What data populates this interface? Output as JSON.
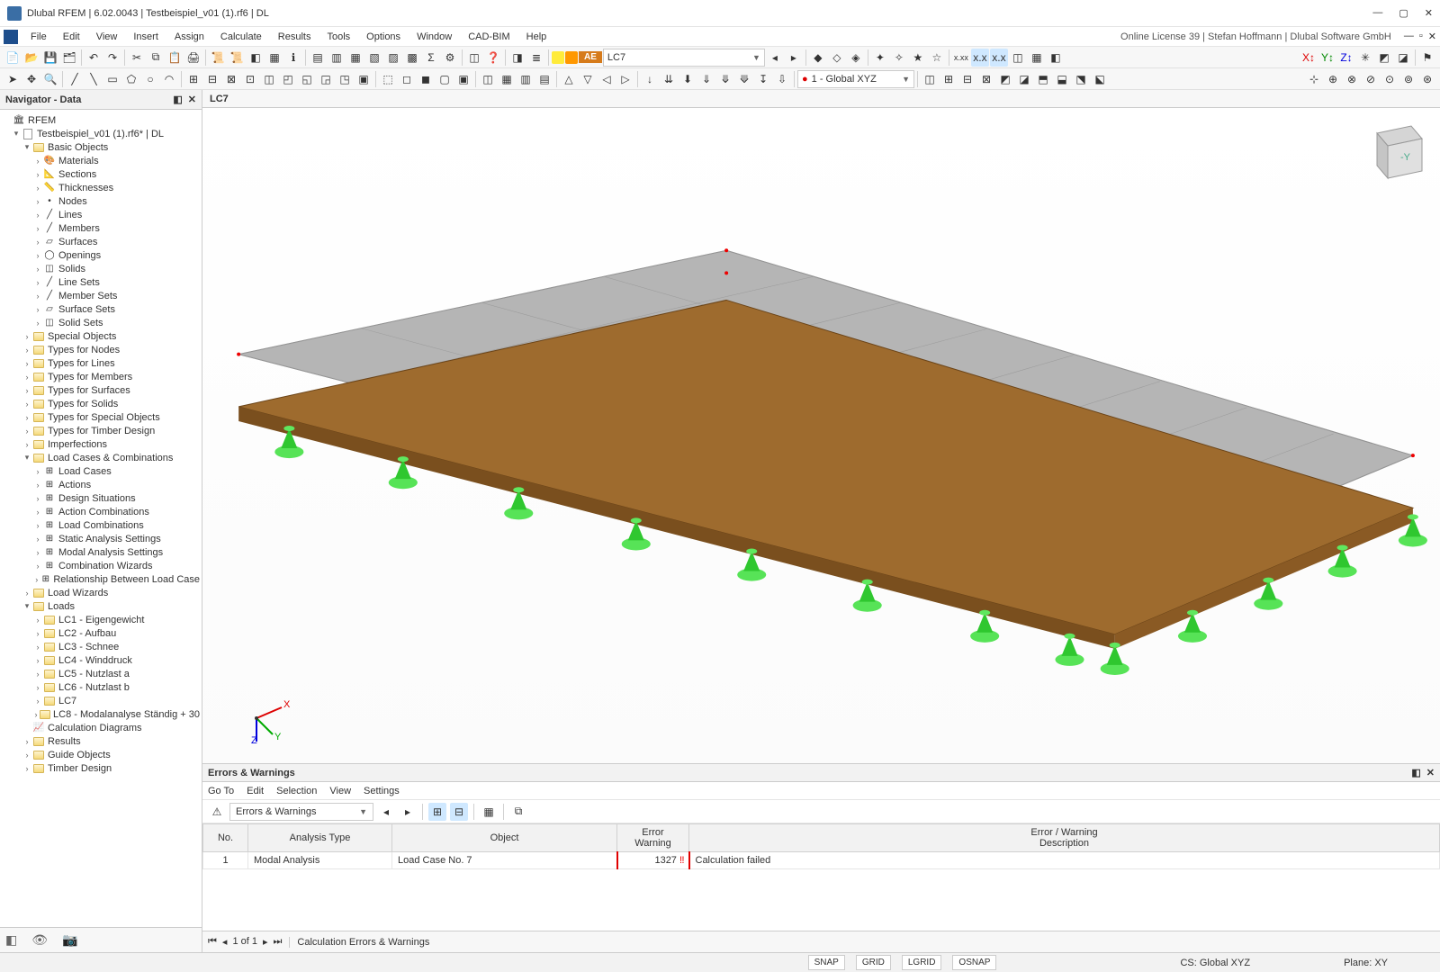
{
  "title": "Dlubal RFEM | 6.02.0043 | Testbeispiel_v01 (1).rf6 | DL",
  "menus": [
    "File",
    "Edit",
    "View",
    "Insert",
    "Assign",
    "Calculate",
    "Results",
    "Tools",
    "Options",
    "Window",
    "CAD-BIM",
    "Help"
  ],
  "rightinfo": "Online License 39 | Stefan Hoffmann | Dlubal Software GmbH",
  "lc_combo": "LC7",
  "coord_combo": "1 - Global XYZ",
  "navigator": {
    "title": "Navigator - Data",
    "root": "RFEM",
    "file": "Testbeispiel_v01 (1).rf6* | DL",
    "basic": "Basic Objects",
    "basic_items": [
      "Materials",
      "Sections",
      "Thicknesses",
      "Nodes",
      "Lines",
      "Members",
      "Surfaces",
      "Openings",
      "Solids",
      "Line Sets",
      "Member Sets",
      "Surface Sets",
      "Solid Sets"
    ],
    "folders1": [
      "Special Objects",
      "Types for Nodes",
      "Types for Lines",
      "Types for Members",
      "Types for Surfaces",
      "Types for Solids",
      "Types for Special Objects",
      "Types for Timber Design",
      "Imperfections"
    ],
    "lcc": "Load Cases & Combinations",
    "lcc_items": [
      "Load Cases",
      "Actions",
      "Design Situations",
      "Action Combinations",
      "Load Combinations",
      "Static Analysis Settings",
      "Modal Analysis Settings",
      "Combination Wizards",
      "Relationship Between Load Case"
    ],
    "lw": "Load Wizards",
    "loads": "Loads",
    "load_items": [
      "LC1 - Eigengewicht",
      "LC2 - Aufbau",
      "LC3 - Schnee",
      "LC4 - Winddruck",
      "LC5 - Nutzlast a",
      "LC6 - Nutzlast b",
      "LC7",
      "LC8 - Modalanalyse Ständig + 30"
    ],
    "tail": [
      "Calculation Diagrams",
      "Results",
      "Guide Objects",
      "Timber Design"
    ]
  },
  "viewport_tab": "LC7",
  "errors": {
    "title": "Errors & Warnings",
    "menu": [
      "Go To",
      "Edit",
      "Selection",
      "View",
      "Settings"
    ],
    "combo": "Errors & Warnings",
    "cols": {
      "no": "No.",
      "atype": "Analysis Type",
      "obj": "Object",
      "ew": "Error\nWarning",
      "desc": "Error / Warning\nDescription"
    },
    "row": {
      "no": "1",
      "atype": "Modal Analysis",
      "obj": "Load Case No. 7",
      "ew": "1327",
      "desc": "Calculation failed"
    },
    "footer_page": "1 of 1",
    "footer_label": "Calculation Errors & Warnings"
  },
  "status": {
    "snap": "SNAP",
    "grid": "GRID",
    "lgrid": "LGRID",
    "osnap": "OSNAP",
    "cs": "CS: Global XYZ",
    "plane": "Plane: XY"
  }
}
